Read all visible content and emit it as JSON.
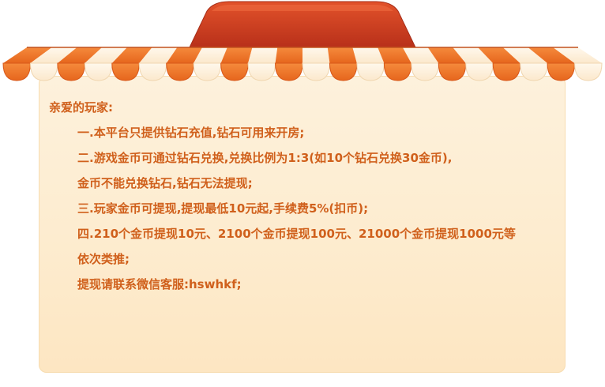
{
  "notice": {
    "greeting": "亲爱的玩家:",
    "lines": [
      "一.本平台只提供钻石充值,钻石可用来开房;",
      "二.游戏金币可通过钻石兑换,兑换比例为1:3(如10个钻石兑换30金币),",
      "金币不能兑换钻石,钻石无法提现;",
      "三.玩家金币可提现,提现最低10元起,手续费5%(扣币);",
      "四.210个金币提现10元、2100个金币提现100元、21000个金币提现1000元等",
      "依次类推;",
      "提现请联系微信客服:hswhkf;"
    ]
  },
  "colors": {
    "awning_orange": "#ec6f22",
    "awning_cream": "#fff3df",
    "roof_red": "#c93b1c",
    "panel_bg": "#fdeccf",
    "text": "#d0601c"
  }
}
